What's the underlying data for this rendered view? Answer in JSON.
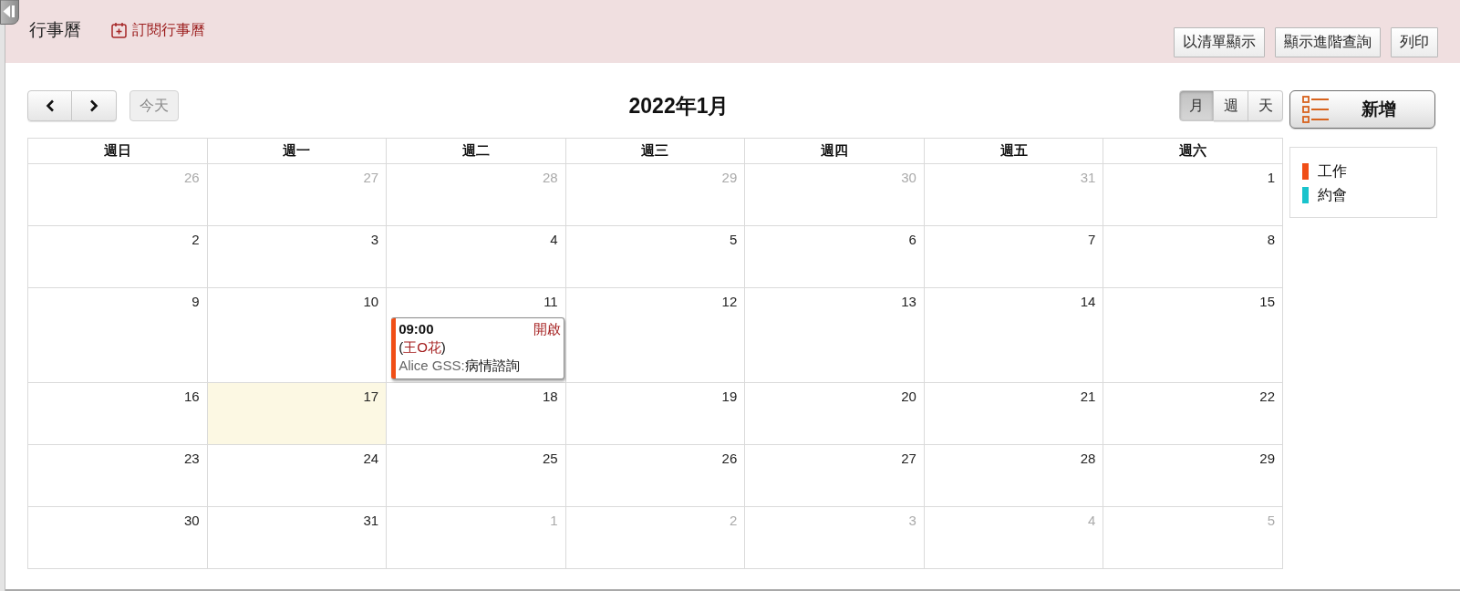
{
  "header": {
    "title": "行事曆",
    "subscribe_link": "訂閱行事曆",
    "buttons": [
      "以清單顯示",
      "顯示進階查詢",
      "列印"
    ]
  },
  "toolbar": {
    "today_button": {
      "label": "今天",
      "disabled": true
    },
    "month_title": "2022年1月",
    "views": [
      {
        "label": "月",
        "selected": true
      },
      {
        "label": "週",
        "selected": false
      },
      {
        "label": "天",
        "selected": false
      }
    ]
  },
  "add_button": {
    "label": "新增"
  },
  "legend": [
    {
      "label": "工作",
      "color": "#f04e16"
    },
    {
      "label": "約會",
      "color": "#19c3cc"
    }
  ],
  "calendar": {
    "weekdays": [
      "週日",
      "週一",
      "週二",
      "週三",
      "週四",
      "週五",
      "週六"
    ],
    "weeks": [
      [
        {
          "day": "26",
          "other_month": true,
          "today": false
        },
        {
          "day": "27",
          "other_month": true,
          "today": false
        },
        {
          "day": "28",
          "other_month": true,
          "today": false
        },
        {
          "day": "29",
          "other_month": true,
          "today": false
        },
        {
          "day": "30",
          "other_month": true,
          "today": false
        },
        {
          "day": "31",
          "other_month": true,
          "today": false
        },
        {
          "day": "1",
          "other_month": false,
          "today": false
        }
      ],
      [
        {
          "day": "2",
          "other_month": false,
          "today": false
        },
        {
          "day": "3",
          "other_month": false,
          "today": false
        },
        {
          "day": "4",
          "other_month": false,
          "today": false
        },
        {
          "day": "5",
          "other_month": false,
          "today": false
        },
        {
          "day": "6",
          "other_month": false,
          "today": false
        },
        {
          "day": "7",
          "other_month": false,
          "today": false
        },
        {
          "day": "8",
          "other_month": false,
          "today": false
        }
      ],
      [
        {
          "day": "9",
          "other_month": false,
          "today": false
        },
        {
          "day": "10",
          "other_month": false,
          "today": false
        },
        {
          "day": "11",
          "other_month": false,
          "today": false,
          "events": [
            {
              "time": "09:00",
              "action": "開啟",
              "patient": {
                "open": "(",
                "name": "王O花",
                "close": ")"
              },
              "organizer": "Alice GSS:",
              "subject": "病情諮詢",
              "color": "#f04e16"
            }
          ]
        },
        {
          "day": "12",
          "other_month": false,
          "today": false
        },
        {
          "day": "13",
          "other_month": false,
          "today": false
        },
        {
          "day": "14",
          "other_month": false,
          "today": false
        },
        {
          "day": "15",
          "other_month": false,
          "today": false
        }
      ],
      [
        {
          "day": "16",
          "other_month": false,
          "today": false
        },
        {
          "day": "17",
          "other_month": false,
          "today": true
        },
        {
          "day": "18",
          "other_month": false,
          "today": false
        },
        {
          "day": "19",
          "other_month": false,
          "today": false
        },
        {
          "day": "20",
          "other_month": false,
          "today": false
        },
        {
          "day": "21",
          "other_month": false,
          "today": false
        },
        {
          "day": "22",
          "other_month": false,
          "today": false
        }
      ],
      [
        {
          "day": "23",
          "other_month": false,
          "today": false
        },
        {
          "day": "24",
          "other_month": false,
          "today": false
        },
        {
          "day": "25",
          "other_month": false,
          "today": false
        },
        {
          "day": "26",
          "other_month": false,
          "today": false
        },
        {
          "day": "27",
          "other_month": false,
          "today": false
        },
        {
          "day": "28",
          "other_month": false,
          "today": false
        },
        {
          "day": "29",
          "other_month": false,
          "today": false
        }
      ],
      [
        {
          "day": "30",
          "other_month": false,
          "today": false
        },
        {
          "day": "31",
          "other_month": false,
          "today": false
        },
        {
          "day": "1",
          "other_month": true,
          "today": false
        },
        {
          "day": "2",
          "other_month": true,
          "today": false
        },
        {
          "day": "3",
          "other_month": true,
          "today": false
        },
        {
          "day": "4",
          "other_month": true,
          "today": false
        },
        {
          "day": "5",
          "other_month": true,
          "today": false
        }
      ]
    ]
  }
}
